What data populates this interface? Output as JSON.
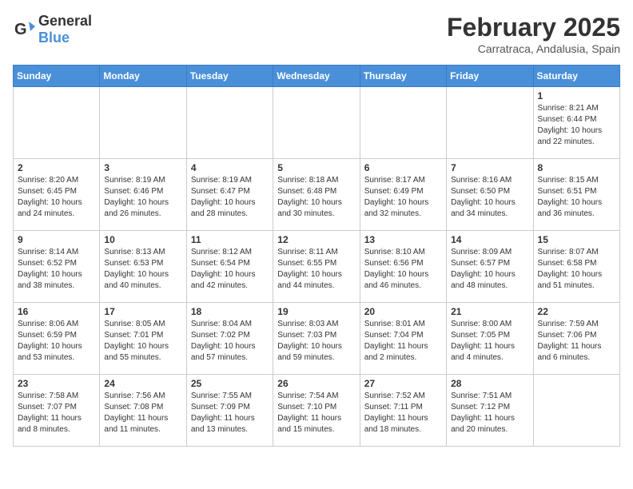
{
  "header": {
    "logo_general": "General",
    "logo_blue": "Blue",
    "month_year": "February 2025",
    "location": "Carratraca, Andalusia, Spain"
  },
  "days_of_week": [
    "Sunday",
    "Monday",
    "Tuesday",
    "Wednesday",
    "Thursday",
    "Friday",
    "Saturday"
  ],
  "weeks": [
    [
      {
        "day": "",
        "info": ""
      },
      {
        "day": "",
        "info": ""
      },
      {
        "day": "",
        "info": ""
      },
      {
        "day": "",
        "info": ""
      },
      {
        "day": "",
        "info": ""
      },
      {
        "day": "",
        "info": ""
      },
      {
        "day": "1",
        "info": "Sunrise: 8:21 AM\nSunset: 6:44 PM\nDaylight: 10 hours and 22 minutes."
      }
    ],
    [
      {
        "day": "2",
        "info": "Sunrise: 8:20 AM\nSunset: 6:45 PM\nDaylight: 10 hours and 24 minutes."
      },
      {
        "day": "3",
        "info": "Sunrise: 8:19 AM\nSunset: 6:46 PM\nDaylight: 10 hours and 26 minutes."
      },
      {
        "day": "4",
        "info": "Sunrise: 8:19 AM\nSunset: 6:47 PM\nDaylight: 10 hours and 28 minutes."
      },
      {
        "day": "5",
        "info": "Sunrise: 8:18 AM\nSunset: 6:48 PM\nDaylight: 10 hours and 30 minutes."
      },
      {
        "day": "6",
        "info": "Sunrise: 8:17 AM\nSunset: 6:49 PM\nDaylight: 10 hours and 32 minutes."
      },
      {
        "day": "7",
        "info": "Sunrise: 8:16 AM\nSunset: 6:50 PM\nDaylight: 10 hours and 34 minutes."
      },
      {
        "day": "8",
        "info": "Sunrise: 8:15 AM\nSunset: 6:51 PM\nDaylight: 10 hours and 36 minutes."
      }
    ],
    [
      {
        "day": "9",
        "info": "Sunrise: 8:14 AM\nSunset: 6:52 PM\nDaylight: 10 hours and 38 minutes."
      },
      {
        "day": "10",
        "info": "Sunrise: 8:13 AM\nSunset: 6:53 PM\nDaylight: 10 hours and 40 minutes."
      },
      {
        "day": "11",
        "info": "Sunrise: 8:12 AM\nSunset: 6:54 PM\nDaylight: 10 hours and 42 minutes."
      },
      {
        "day": "12",
        "info": "Sunrise: 8:11 AM\nSunset: 6:55 PM\nDaylight: 10 hours and 44 minutes."
      },
      {
        "day": "13",
        "info": "Sunrise: 8:10 AM\nSunset: 6:56 PM\nDaylight: 10 hours and 46 minutes."
      },
      {
        "day": "14",
        "info": "Sunrise: 8:09 AM\nSunset: 6:57 PM\nDaylight: 10 hours and 48 minutes."
      },
      {
        "day": "15",
        "info": "Sunrise: 8:07 AM\nSunset: 6:58 PM\nDaylight: 10 hours and 51 minutes."
      }
    ],
    [
      {
        "day": "16",
        "info": "Sunrise: 8:06 AM\nSunset: 6:59 PM\nDaylight: 10 hours and 53 minutes."
      },
      {
        "day": "17",
        "info": "Sunrise: 8:05 AM\nSunset: 7:01 PM\nDaylight: 10 hours and 55 minutes."
      },
      {
        "day": "18",
        "info": "Sunrise: 8:04 AM\nSunset: 7:02 PM\nDaylight: 10 hours and 57 minutes."
      },
      {
        "day": "19",
        "info": "Sunrise: 8:03 AM\nSunset: 7:03 PM\nDaylight: 10 hours and 59 minutes."
      },
      {
        "day": "20",
        "info": "Sunrise: 8:01 AM\nSunset: 7:04 PM\nDaylight: 11 hours and 2 minutes."
      },
      {
        "day": "21",
        "info": "Sunrise: 8:00 AM\nSunset: 7:05 PM\nDaylight: 11 hours and 4 minutes."
      },
      {
        "day": "22",
        "info": "Sunrise: 7:59 AM\nSunset: 7:06 PM\nDaylight: 11 hours and 6 minutes."
      }
    ],
    [
      {
        "day": "23",
        "info": "Sunrise: 7:58 AM\nSunset: 7:07 PM\nDaylight: 11 hours and 8 minutes."
      },
      {
        "day": "24",
        "info": "Sunrise: 7:56 AM\nSunset: 7:08 PM\nDaylight: 11 hours and 11 minutes."
      },
      {
        "day": "25",
        "info": "Sunrise: 7:55 AM\nSunset: 7:09 PM\nDaylight: 11 hours and 13 minutes."
      },
      {
        "day": "26",
        "info": "Sunrise: 7:54 AM\nSunset: 7:10 PM\nDaylight: 11 hours and 15 minutes."
      },
      {
        "day": "27",
        "info": "Sunrise: 7:52 AM\nSunset: 7:11 PM\nDaylight: 11 hours and 18 minutes."
      },
      {
        "day": "28",
        "info": "Sunrise: 7:51 AM\nSunset: 7:12 PM\nDaylight: 11 hours and 20 minutes."
      },
      {
        "day": "",
        "info": ""
      }
    ]
  ]
}
